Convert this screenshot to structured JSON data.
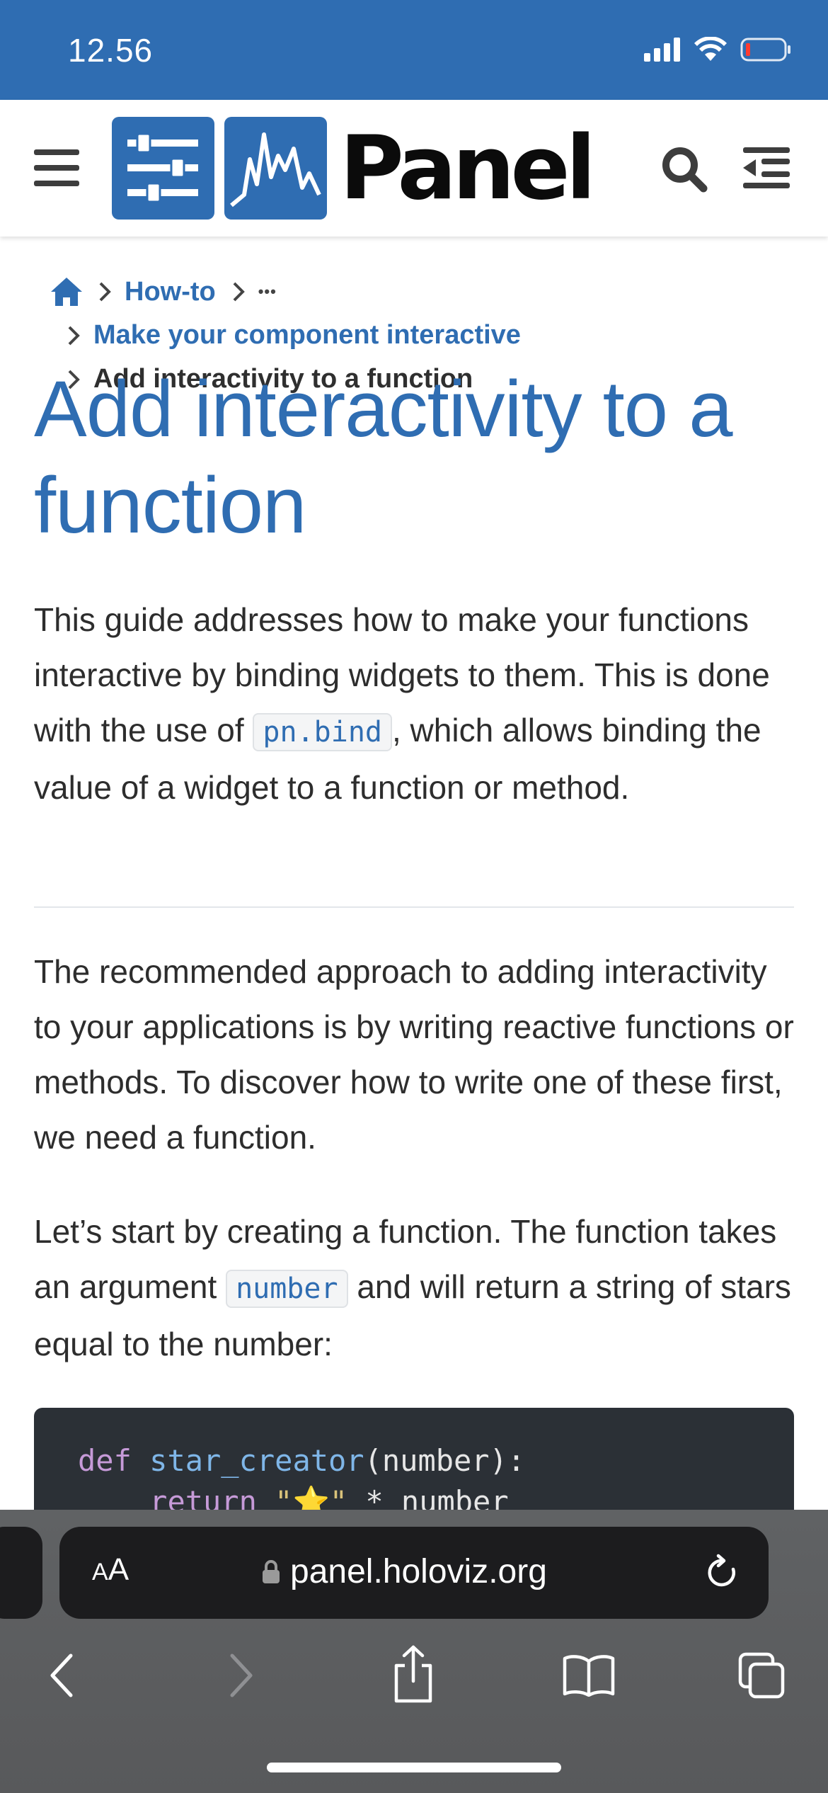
{
  "status_bar": {
    "time": "12.56"
  },
  "header": {
    "logo_text": "Panel",
    "brand_color": "#2f6db2"
  },
  "breadcrumb": {
    "items": [
      {
        "label": "How-to"
      },
      {
        "label": "•••"
      },
      {
        "label": "Make your component interactive"
      },
      {
        "label": "Add interactivity to a function"
      }
    ]
  },
  "article": {
    "title": "Add interactivity to a function",
    "intro": {
      "part1": "This guide addresses how to make your functions interactive by binding widgets to them. This is done with the use of ",
      "code": "pn.bind",
      "part2": ", which allows binding the value of a widget to a function or method."
    },
    "para2": "The recommended approach to adding interactivity to your applications is by writing reactive functions or methods. To discover how to write one of these first, we need a function.",
    "para3": {
      "part1": "Let’s start by creating a function. The function takes an argument ",
      "code": "number",
      "part2": " and will return a string of stars equal to the number:"
    },
    "code_block": {
      "kw_def": "def",
      "fn_name": "star_creator",
      "params": "(number):",
      "kw_return": "return",
      "string": "\"⭐\"",
      "rest": " * number"
    }
  },
  "safari": {
    "text_size_label": "AA",
    "url": "panel.holoviz.org"
  }
}
